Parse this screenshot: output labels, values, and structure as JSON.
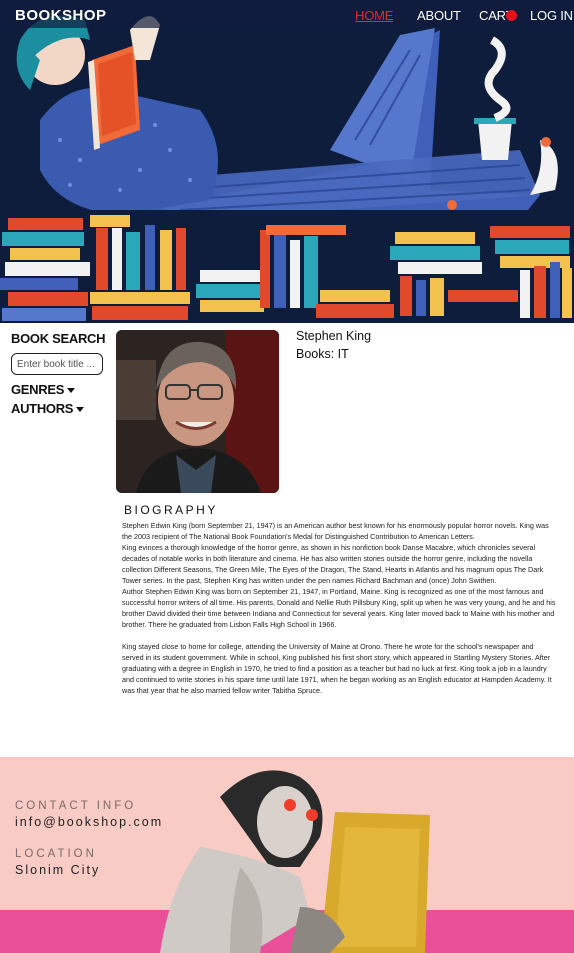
{
  "nav": {
    "brand": "BOOKSHOP",
    "links": [
      "HOME",
      "ABOUT",
      "CART",
      "LOG IN"
    ],
    "active": "HOME",
    "accent_color": "#e8262b"
  },
  "sidebar": {
    "search_title": "BOOK SEARCH",
    "search_placeholder": "Enter book title ...",
    "genres_label": "GENRES",
    "authors_label": "AUTHORS"
  },
  "author": {
    "name": "Stephen King",
    "books": "Books: IT",
    "biography_title": "BIOGRAPHY",
    "biography": [
      "Stephen Edwin King (born September 21, 1947) is an American author best known for his enormously popular horror novels. King was the 2003 recipient of The National Book Foundation's Medal for Distinguished Contribution to American Letters.",
      "King evinces a thorough knowledge of the horror genre, as shown in his nonfiction book Danse Macabre, which chronicles several decades of notable works in both literature and cinema. He has also written stories outside the horror genre, including the novella collection Different Seasons, The Green Mile, The Eyes of the Dragon, The Stand, Hearts in Atlantis and his magnum opus The Dark Tower series. In the past, Stephen King has written under the pen names Richard Bachman and (once) John Swithen.",
      "Author Stephen Edwin King was born on September 21, 1947, in Portland, Maine. King is recognized as one of the most famous and successful horror writers of all time. His parents, Donald and Nellie Ruth Pillsbury King, split up when he was very young, and he and his brother David divided their time between Indiana and Connecticut for several years. King later moved back to Maine with his mother and brother. There he graduated from Lisbon Falls High School in 1966.",
      "",
      "King stayed close to home for college, attending the University of Maine at Orono. There he wrote for the school's newspaper and served in its student government. While in school, King published his first short story, which appeared in Startling Mystery Stories. After graduating with a degree in English in 1970, he tried to find a position as a teacher but had no luck at first. King took a job in a laundry and continued to write stories in his spare time until late 1971, when he began working as an English educator at Hampden Academy. It was that year that he also married fellow writer Tabitha Spruce."
    ]
  },
  "footer": {
    "contact_label": "CONTACT INFO",
    "contact_value": "info@bookshop.com",
    "location_label": "LOCATION",
    "location_value": "Slonim City",
    "colors": {
      "background": "#f8cbc4",
      "band": "#ea4f9a"
    }
  }
}
